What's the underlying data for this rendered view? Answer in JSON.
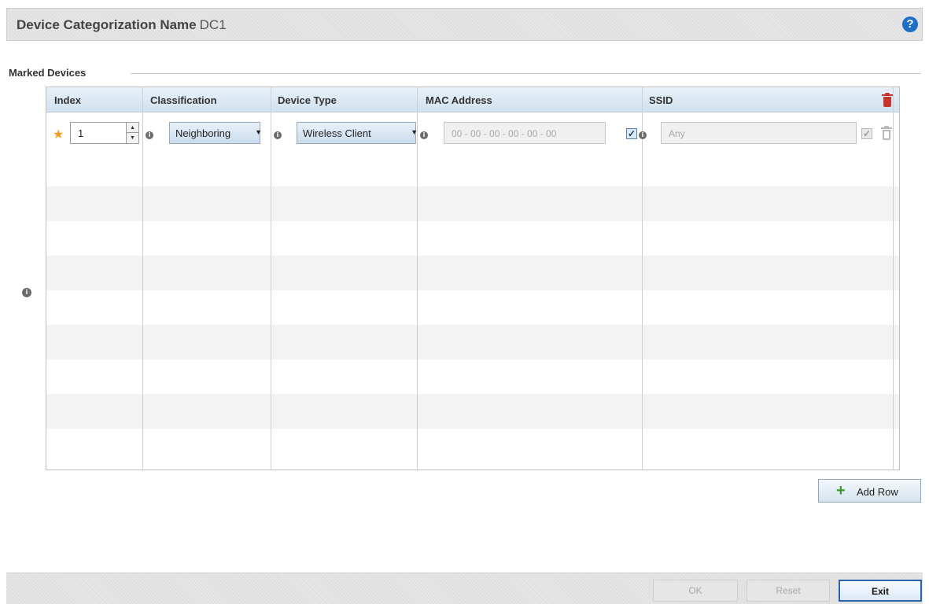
{
  "header": {
    "title_label": "Device Categorization Name",
    "title_value": "DC1"
  },
  "section": {
    "label": "Marked Devices"
  },
  "table": {
    "columns": [
      "Index",
      "Classification",
      "Device Type",
      "MAC Address",
      "SSID"
    ],
    "rows": [
      {
        "index": "1",
        "classification": "Neighboring",
        "device_type": "Wireless Client",
        "mac_address_placeholder": "00 - 00 - 00 - 00 - 00 - 00",
        "mac_any_checked": true,
        "ssid": "Any",
        "ssid_any_checked": true
      }
    ]
  },
  "buttons": {
    "add_row": "Add Row",
    "ok": "OK",
    "reset": "Reset",
    "exit": "Exit"
  },
  "icons": {
    "help": "help-icon",
    "info": "info-icon",
    "required": "star-icon",
    "delete": "trash-icon",
    "add": "plus-icon"
  },
  "colors": {
    "accent": "#1f6fc9",
    "delete": "#c9342a",
    "add": "#3a9a2a",
    "required": "#f29b1c"
  }
}
